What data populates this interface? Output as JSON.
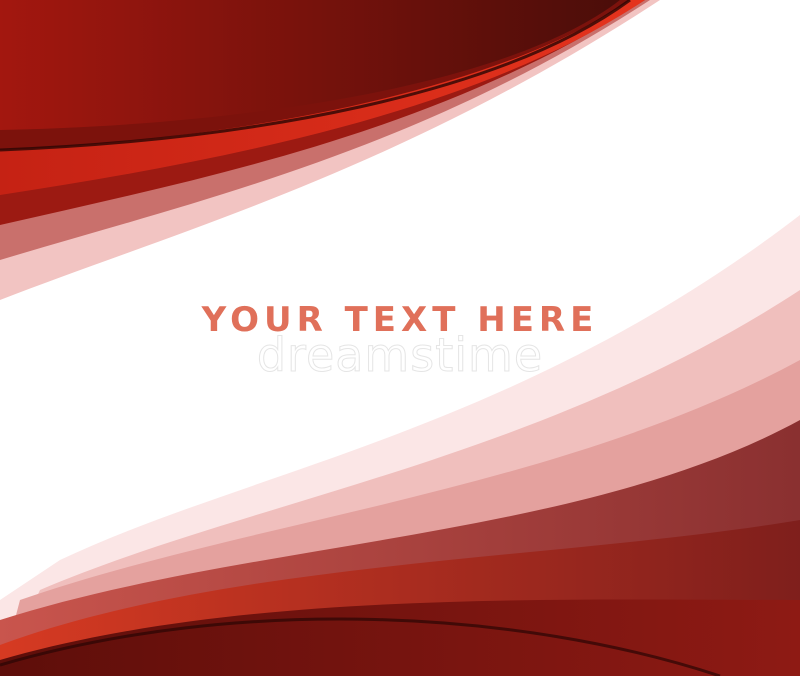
{
  "headline": "YOUR TEXT HERE",
  "watermark": "dreamstime",
  "colors": {
    "dark_red": "#5a0f0c",
    "red": "#b3261c",
    "bright_red": "#e23a22",
    "pink": "#e6a7a4",
    "light_pink": "#f6dcdb",
    "text": "#e0705a"
  }
}
